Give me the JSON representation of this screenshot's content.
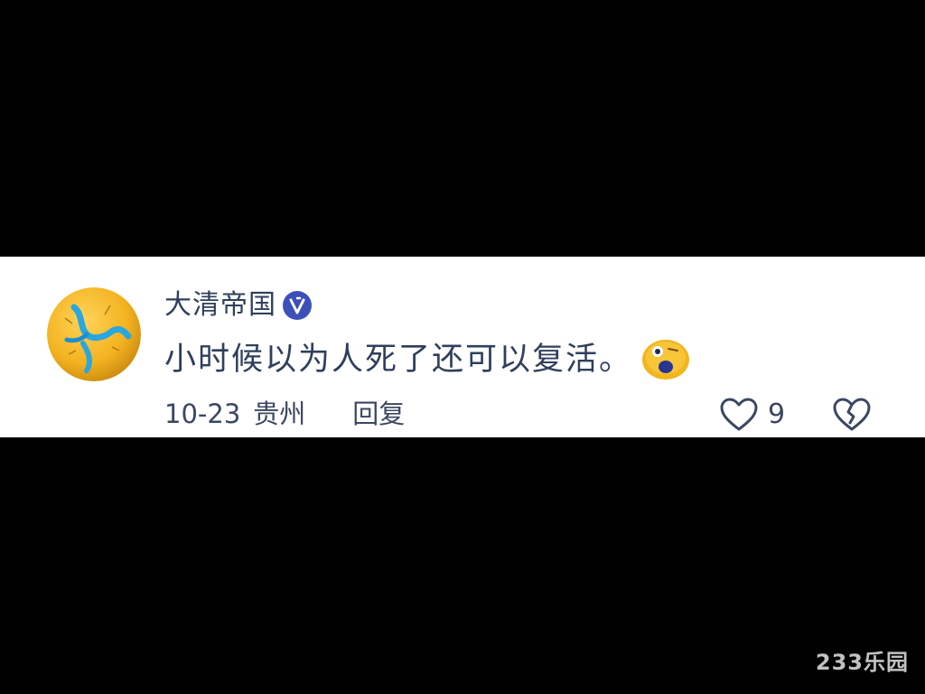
{
  "comment": {
    "username": "大清帝国",
    "verified_icon": "verified-badge-icon",
    "avatar_icon": "yellow-ball-avatar",
    "text": "小时候以为人死了还可以复活。",
    "emoji_icon": "yellow-shocked-face-emoji",
    "date": "10-23",
    "location": "贵州",
    "reply_label": "回复",
    "like_icon": "heart-outline-icon",
    "like_count": "9",
    "dislike_icon": "broken-heart-outline-icon"
  },
  "watermark": {
    "text": "233乐园"
  },
  "colors": {
    "background": "#000000",
    "card": "#ffffff",
    "text": "#2f3f5c",
    "accent": "#3d4fb8",
    "avatar_yellow": "#f5b82a",
    "avatar_blue": "#2aa7e0"
  }
}
